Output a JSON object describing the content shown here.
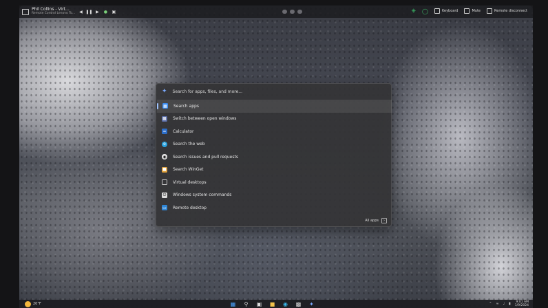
{
  "topbar": {
    "title": "Phil Collins - Virt…",
    "subtitle": "Remote Control Lenovo To…",
    "right_items": [
      "Keyboard",
      "Mute",
      "Remote disconnect"
    ]
  },
  "launcher": {
    "search_placeholder": "Search for apps, files, and more...",
    "items": [
      {
        "label": "Search apps",
        "icon": "apps-icon",
        "color": "#3b8cf0"
      },
      {
        "label": "Switch between open windows",
        "icon": "windows-switch-icon",
        "color": "#5b6ea8"
      },
      {
        "label": "Calculator",
        "icon": "calculator-icon",
        "color": "#2d6ec9"
      },
      {
        "label": "Search the web",
        "icon": "web-icon",
        "color": "#2aa4e0"
      },
      {
        "label": "Search issues and pull requests",
        "icon": "github-icon",
        "color": "#222222"
      },
      {
        "label": "Search WinGet",
        "icon": "winget-icon",
        "color": "#e3a33b"
      },
      {
        "label": "Virtual desktops",
        "icon": "desktops-icon",
        "color": "#6c6c6c"
      },
      {
        "label": "Windows system commands",
        "icon": "power-icon",
        "color": "#3c3c3c"
      },
      {
        "label": "Remote desktop",
        "icon": "remote-desktop-icon",
        "color": "#2f86d6"
      }
    ],
    "footer_label": "All apps"
  },
  "taskbar": {
    "weather": "20°F",
    "clock_time": "9:01 AM",
    "clock_date": "1/9/2024"
  }
}
